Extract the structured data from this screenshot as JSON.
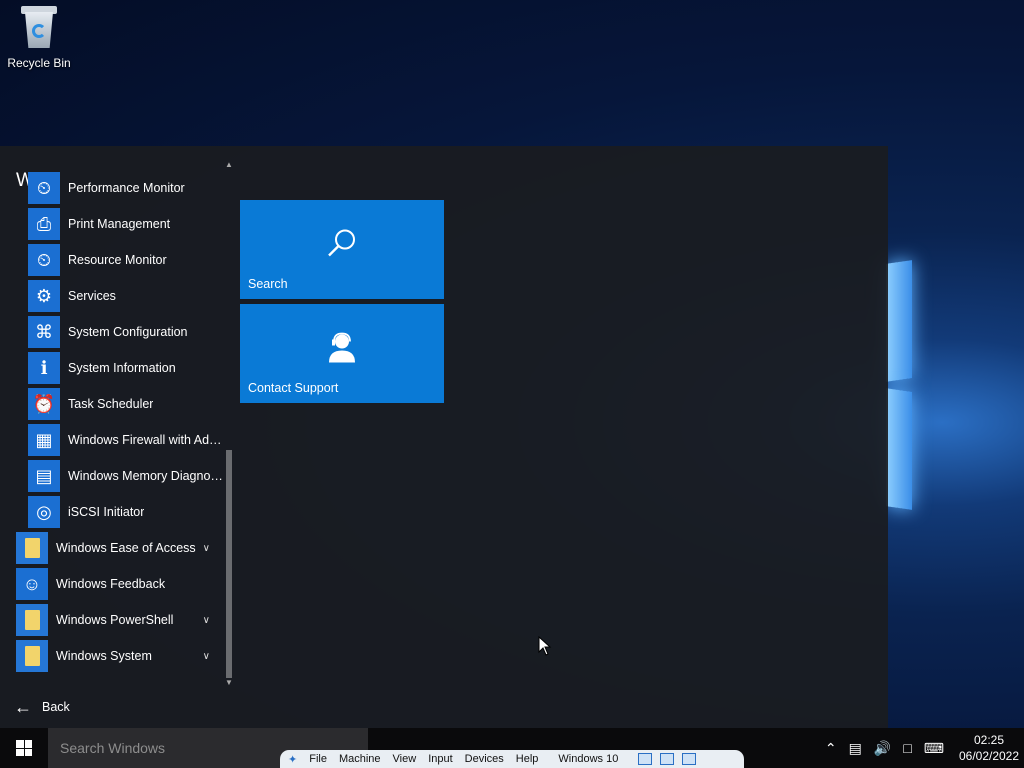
{
  "desktop": {
    "recycle_bin_label": "Recycle Bin"
  },
  "start_menu": {
    "letter_header": "W",
    "apps": [
      {
        "label": "Performance Monitor",
        "icon": "performance-monitor-icon",
        "folder": false
      },
      {
        "label": "Print Management",
        "icon": "print-management-icon",
        "folder": false
      },
      {
        "label": "Resource Monitor",
        "icon": "resource-monitor-icon",
        "folder": false
      },
      {
        "label": "Services",
        "icon": "services-gear-icon",
        "folder": false
      },
      {
        "label": "System Configuration",
        "icon": "system-configuration-icon",
        "folder": false
      },
      {
        "label": "System Information",
        "icon": "system-information-icon",
        "folder": false
      },
      {
        "label": "Task Scheduler",
        "icon": "task-scheduler-clock-icon",
        "folder": false
      },
      {
        "label": "Windows Firewall with Adv...",
        "icon": "firewall-icon",
        "folder": false
      },
      {
        "label": "Windows Memory Diagnos...",
        "icon": "memory-chip-icon",
        "folder": false
      },
      {
        "label": "iSCSI Initiator",
        "icon": "iscsi-globe-icon",
        "folder": false
      },
      {
        "label": "Windows Ease of Access",
        "icon": "folder-icon",
        "folder": true
      },
      {
        "label": "Windows Feedback",
        "icon": "feedback-icon",
        "folder": false
      },
      {
        "label": "Windows PowerShell",
        "icon": "folder-icon",
        "folder": true
      },
      {
        "label": "Windows System",
        "icon": "folder-icon",
        "folder": true
      }
    ],
    "back_label": "Back",
    "tiles": [
      {
        "label": "Search",
        "icon": "search-icon"
      },
      {
        "label": "Contact Support",
        "icon": "contact-support-icon"
      }
    ]
  },
  "taskbar": {
    "search_placeholder": "Search Windows",
    "time": "02:25",
    "date": "06/02/2022"
  },
  "vbox_toolbar": {
    "menus": [
      "File",
      "Machine",
      "View",
      "Input",
      "Devices",
      "Help"
    ],
    "title": "Windows 10"
  },
  "colors": {
    "tile_blue": "#0a7ad6",
    "menu_bg": "#1a1c20",
    "taskbar_bg": "#0a0a0c"
  }
}
